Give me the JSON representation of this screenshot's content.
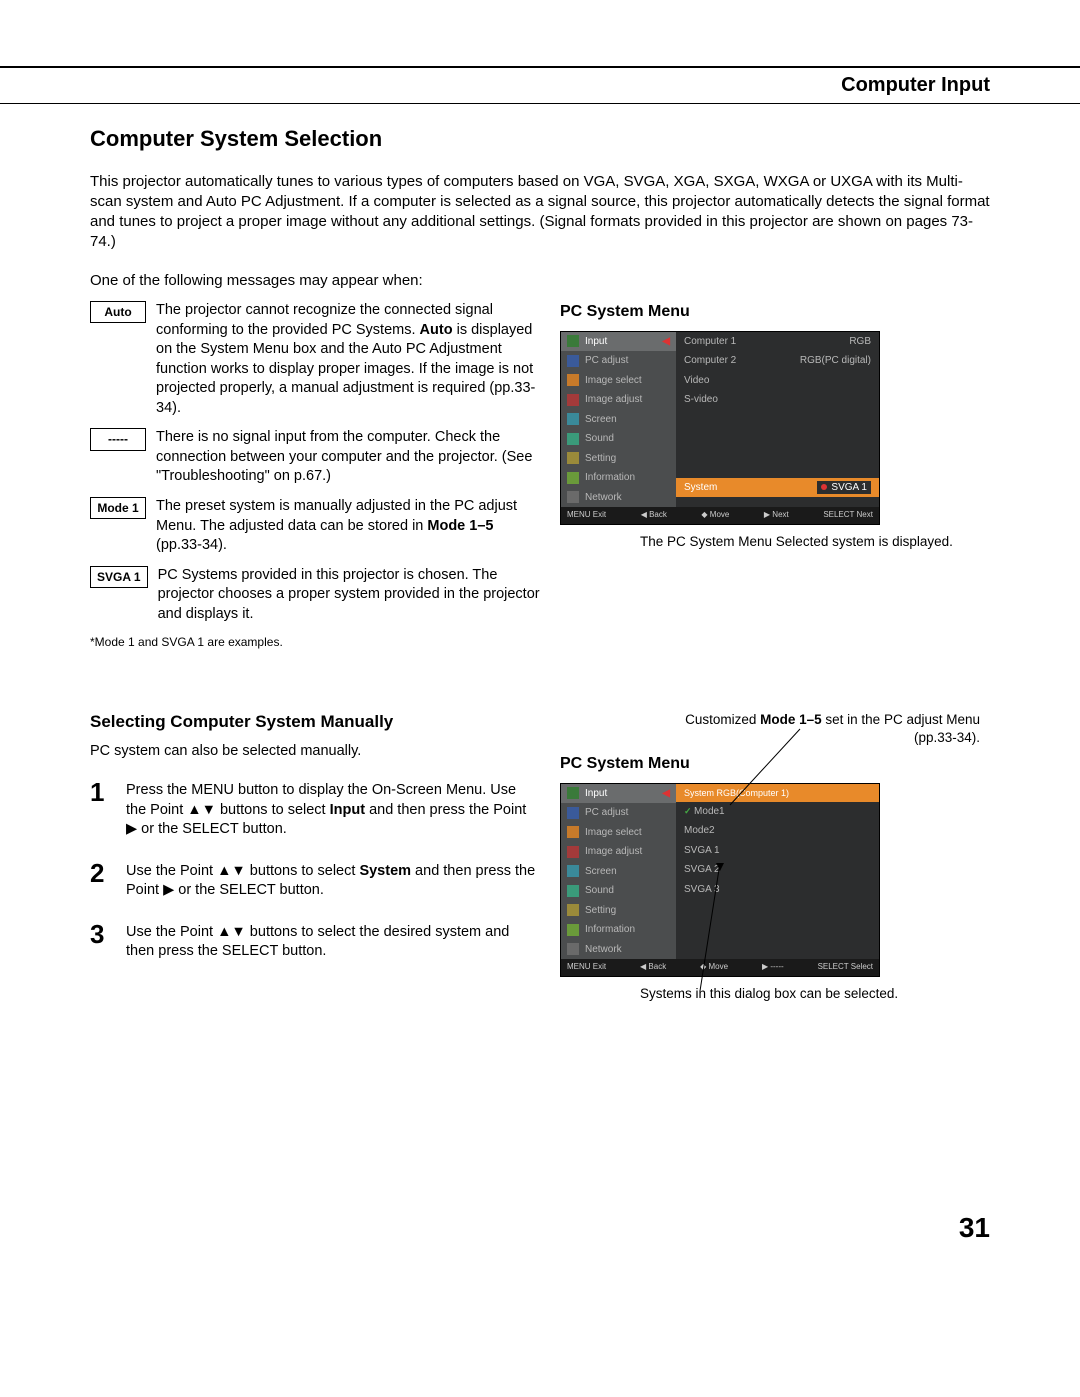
{
  "header": {
    "title": "Computer Input"
  },
  "section": {
    "title": "Computer System Selection",
    "intro": "This projector automatically tunes to various types of computers based on VGA, SVGA, XGA, SXGA, WXGA or UXGA with its Multi-scan system and Auto PC Adjustment. If a computer is selected as a signal source, this projector automatically detects the signal format and tunes to project a proper image without any additional settings. (Signal formats provided in this projector are shown on pages 73-74.)",
    "msg_intro": "One of the following messages may appear when:"
  },
  "messages": [
    {
      "label": "Auto",
      "text_parts": [
        "The projector cannot recognize the connected signal conforming to the provided PC Systems. ",
        "Auto",
        " is displayed on the System Menu box and the Auto PC Adjustment function works to display proper images. If the image is not projected properly, a manual adjustment is required (pp.33-34)."
      ]
    },
    {
      "label": "-----",
      "text": "There is no signal input from the computer. Check the connection between your computer and the projector. (See \"Troubleshooting\" on p.67.)"
    },
    {
      "label": "Mode 1",
      "text_parts": [
        "The preset system is manually adjusted in the PC adjust Menu. The adjusted data can be stored in ",
        "Mode 1–5",
        " (pp.33-34)."
      ]
    },
    {
      "label": "SVGA 1",
      "text": "PC Systems provided in this projector is chosen. The projector chooses a proper system provided in the projector and displays it."
    }
  ],
  "footnote": "*Mode 1 and SVGA 1 are examples.",
  "osd1": {
    "title": "PC System Menu",
    "side": [
      "Input",
      "PC adjust",
      "Image select",
      "Image adjust",
      "Screen",
      "Sound",
      "Setting",
      "Information",
      "Network"
    ],
    "main_rows": [
      {
        "l": "Computer 1",
        "r": "RGB"
      },
      {
        "l": "Computer 2",
        "r": "RGB(PC digital)"
      },
      {
        "l": "Video",
        "r": ""
      },
      {
        "l": "S-video",
        "r": ""
      }
    ],
    "highlight": {
      "l": "System",
      "r": "SVGA 1"
    },
    "status": {
      "a": "MENU Exit",
      "b": "◀ Back",
      "c": "◆ Move",
      "d": "▶ Next",
      "e": "SELECT Next"
    },
    "caption": "The PC System Menu Selected system is displayed."
  },
  "manual": {
    "title": "Selecting Computer System Manually",
    "intro": "PC system can also be selected manually.",
    "steps": [
      {
        "n": "1",
        "parts": [
          "Press the MENU button to display the On-Screen Menu. Use the Point ▲▼ buttons to select ",
          "Input",
          " and then press the Point ▶ or the SELECT button."
        ]
      },
      {
        "n": "2",
        "parts": [
          "Use the Point ▲▼ buttons to select ",
          "System",
          " and then press the Point ▶ or the SELECT button."
        ]
      },
      {
        "n": "3",
        "parts": [
          "Use the Point ▲▼ buttons to select the desired system and then press the SELECT button."
        ]
      }
    ]
  },
  "osd2": {
    "title": "PC System Menu",
    "note_parts": [
      "Customized ",
      "Mode 1–5",
      " set in the PC adjust Menu (pp.33-34)."
    ],
    "side": [
      "Input",
      "PC adjust",
      "Image select",
      "Image adjust",
      "Screen",
      "Sound",
      "Setting",
      "Information",
      "Network"
    ],
    "header_bar": "System     RGB(Computer 1)",
    "list": [
      "Mode1",
      "Mode2",
      "SVGA 1",
      "SVGA 2",
      "SVGA 3"
    ],
    "status": {
      "a": "MENU Exit",
      "b": "◀ Back",
      "c": "◆ Move",
      "d": "▶ -----",
      "e": "SELECT Select"
    },
    "caption": "Systems in this dialog box can be selected."
  },
  "page_number": "31"
}
